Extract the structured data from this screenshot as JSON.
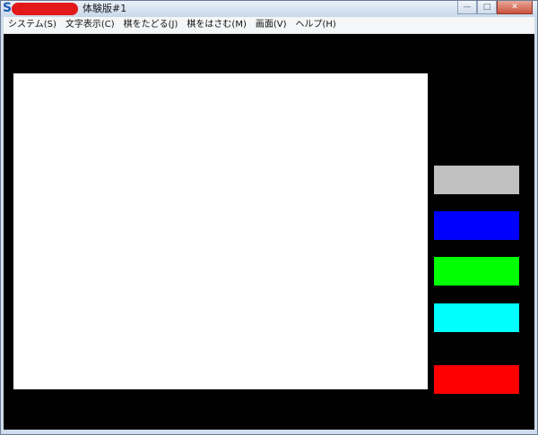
{
  "window": {
    "title": "体験版#1",
    "app_icon_glyph": "S",
    "minimize_glyph": "—",
    "maximize_glyph": "□",
    "close_glyph": "✕"
  },
  "menu": {
    "items": [
      "システム(S)",
      "文字表示(C)",
      "棋をたどる(J)",
      "棋をはさむ(M)",
      "画面(V)",
      "ヘルプ(H)"
    ]
  },
  "colors": {
    "client_background": "#000000",
    "canvas": "#ffffff",
    "swatches": [
      "#c0c0c0",
      "#0000ff",
      "#00ff00",
      "#00ffff",
      "#ff0000"
    ]
  },
  "icons": {
    "app": "app-icon",
    "minimize": "minimize-icon",
    "maximize": "maximize-icon",
    "close": "close-icon"
  }
}
